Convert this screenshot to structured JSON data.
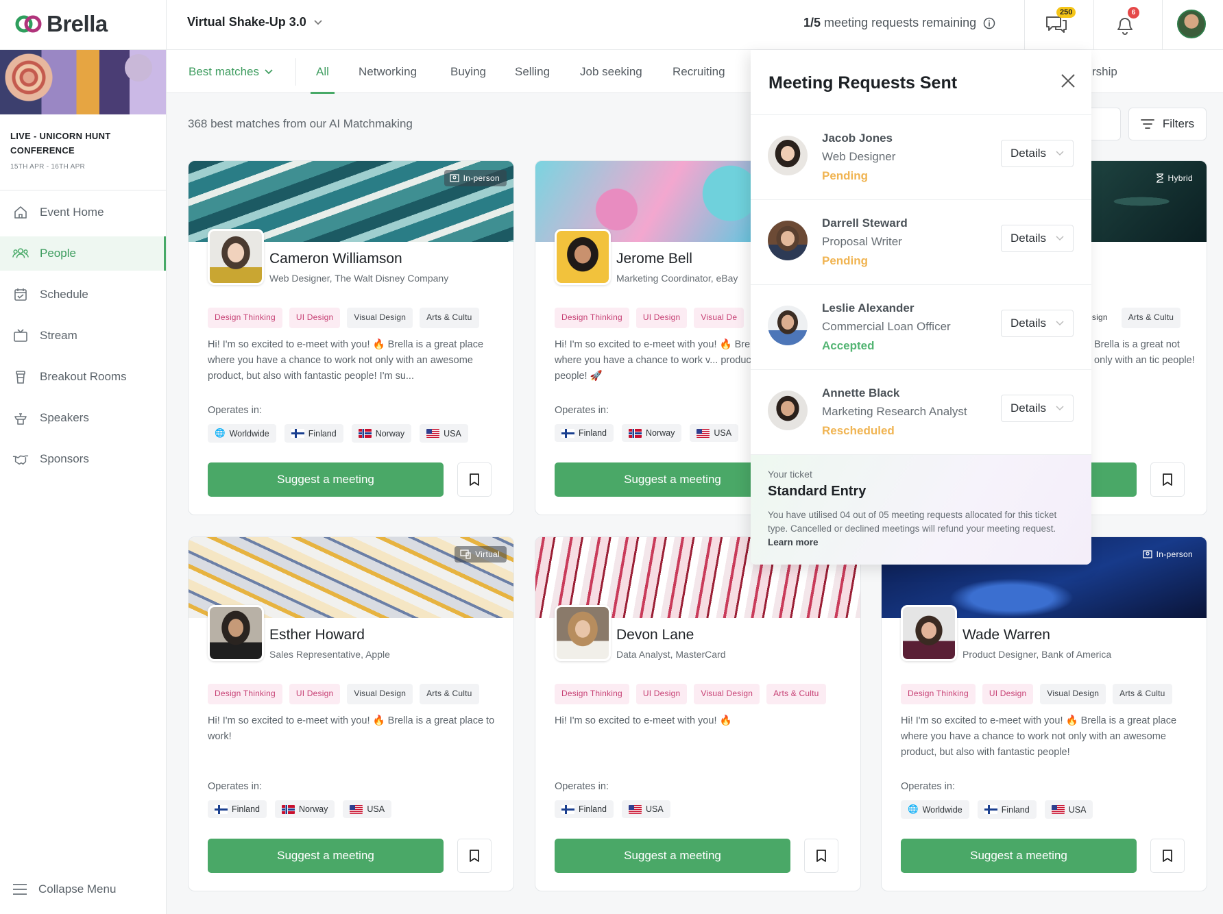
{
  "brand": {
    "logo_text": "Brella",
    "accent": "#4aa867"
  },
  "header": {
    "event_name": "Virtual Shake-Up 3.0",
    "remaining_count": "1/5",
    "remaining_text": "meeting requests remaining",
    "chat_badge": "250",
    "notif_badge": "6"
  },
  "sidebar": {
    "conference_line1": "LIVE - UNICORN HUNT",
    "conference_line2": "CONFERENCE",
    "dates": "15TH APR - 16TH APR",
    "items": [
      {
        "label": "Event Home",
        "icon": "home-icon"
      },
      {
        "label": "People",
        "icon": "people-icon",
        "active": true
      },
      {
        "label": "Schedule",
        "icon": "calendar-icon"
      },
      {
        "label": "Stream",
        "icon": "tv-icon"
      },
      {
        "label": "Breakout Rooms",
        "icon": "cup-icon"
      },
      {
        "label": "Speakers",
        "icon": "podium-icon"
      },
      {
        "label": "Sponsors",
        "icon": "handshake-icon"
      }
    ],
    "collapse_label": "Collapse Menu"
  },
  "tabs": {
    "sort_label": "Best matches",
    "items": [
      "All",
      "Networking",
      "Buying",
      "Selling",
      "Job seeking",
      "Recruiting",
      "rship"
    ]
  },
  "content": {
    "count_text": "368 best matches from our AI Matchmaking",
    "filters_label": "Filters",
    "operates_label": "Operates in:",
    "suggest_label": "Suggest a meeting"
  },
  "cards": [
    {
      "name": "Cameron Williamson",
      "title": "Web Designer, The Walt Disney Company",
      "mode": "In-person",
      "tags": [
        "Design Thinking",
        "UI Design",
        "Visual Design",
        "Arts & Cultu"
      ],
      "bio": "Hi! I'm so excited to e-meet with you! 🔥 Brella is a great place where you have a chance to work not only with an awesome product, but also with fantastic people! I'm su...",
      "regions": [
        "Worldwide",
        "Finland",
        "Norway",
        "USA"
      ]
    },
    {
      "name": "Jerome Bell",
      "title": "Marketing Coordinator, eBay",
      "mode": "",
      "tags": [
        "Design Thinking",
        "UI Design",
        "Visual De"
      ],
      "bio": "Hi! I'm so excited to e-meet with you! 🔥 Brella is a great place where you have a chance to work v... product and fantastic people! 🚀",
      "regions": [
        "Finland",
        "Norway",
        "USA"
      ]
    },
    {
      "name": "",
      "title": "",
      "mode": "Hybrid",
      "tags": [
        "esign",
        "Arts & Cultu"
      ],
      "bio": "Brella is a great not only with an tic people!",
      "regions": []
    },
    {
      "name": "Esther Howard",
      "title": "Sales Representative, Apple",
      "mode": "Virtual",
      "tags": [
        "Design Thinking",
        "UI Design",
        "Visual Design",
        "Arts & Cultu"
      ],
      "bio": "Hi! I'm so excited to e-meet with you! 🔥 Brella is a great place to work!",
      "regions": [
        "Finland",
        "Norway",
        "USA"
      ]
    },
    {
      "name": "Devon Lane",
      "title": "Data Analyst, MasterCard",
      "mode": "",
      "tags": [
        "Design Thinking",
        "UI Design",
        "Visual Design",
        "Arts & Cultu"
      ],
      "bio": "Hi! I'm so excited to e-meet with you! 🔥",
      "regions": [
        "Finland",
        "USA"
      ]
    },
    {
      "name": "Wade Warren",
      "title": "Product Designer, Bank of America",
      "mode": "In-person",
      "tags": [
        "Design Thinking",
        "UI Design",
        "Visual Design",
        "Arts & Cultu"
      ],
      "bio": "Hi! I'm so excited to e-meet with you! 🔥 Brella is a great place where you have a chance to work not only with an awesome product, but also with fantastic people!",
      "regions": [
        "Worldwide",
        "Finland",
        "USA"
      ]
    }
  ],
  "panel": {
    "title": "Meeting Requests Sent",
    "details_label": "Details",
    "requests": [
      {
        "name": "Jacob Jones",
        "role": "Web Designer",
        "status": "Pending"
      },
      {
        "name": "Darrell Steward",
        "role": "Proposal Writer",
        "status": "Pending"
      },
      {
        "name": "Leslie Alexander",
        "role": "Commercial Loan Officer",
        "status": "Accepted"
      },
      {
        "name": "Annette Black",
        "role": "Marketing Research Analyst",
        "status": "Rescheduled"
      }
    ],
    "ticket_label": "Your ticket",
    "ticket_name": "Standard Entry",
    "ticket_desc": "You have utilised 04 out of 05 meeting requests allocated for this ticket type. Cancelled or declined meetings will refund your meeting request.",
    "ticket_link": "Learn more"
  }
}
